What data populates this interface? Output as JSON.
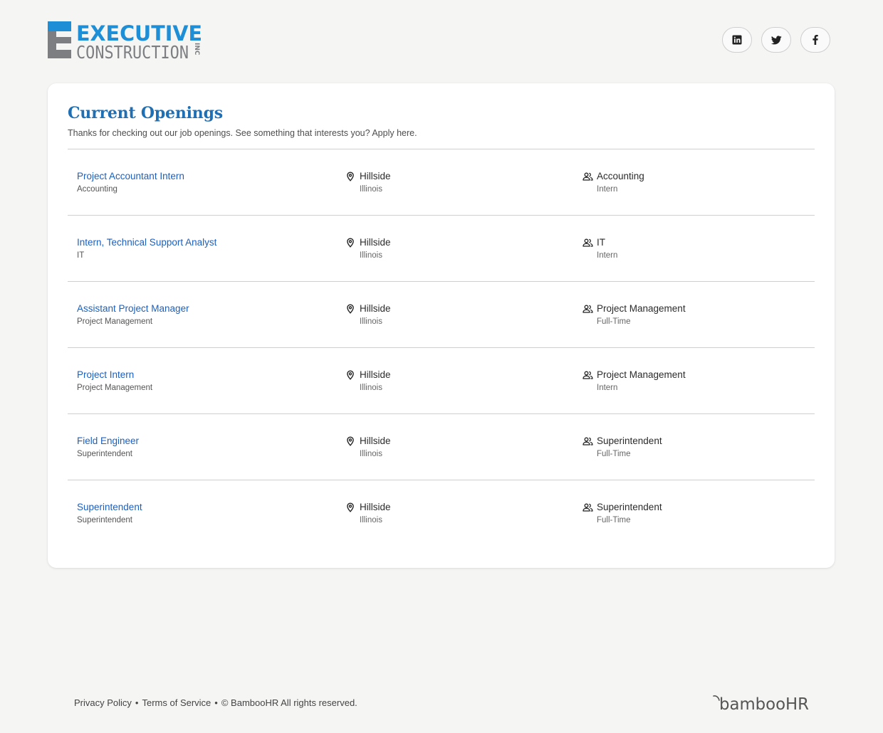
{
  "header": {
    "logo": {
      "line1": "EXECUTIVE",
      "line2": "CONSTRUCTION",
      "suffix": "INC",
      "colors": {
        "blue": "#1e8fd6",
        "gray": "#7c7e81"
      }
    },
    "social": [
      {
        "name": "linkedin",
        "icon": "linkedin-icon"
      },
      {
        "name": "twitter",
        "icon": "twitter-icon"
      },
      {
        "name": "facebook",
        "icon": "facebook-icon"
      }
    ]
  },
  "openings": {
    "title": "Current Openings",
    "subtitle": "Thanks for checking out our job openings. See something that interests you? Apply here.",
    "jobs": [
      {
        "title": "Project Accountant Intern",
        "department": "Accounting",
        "city": "Hillside",
        "state": "Illinois",
        "team": "Accounting",
        "employment_type": "Intern"
      },
      {
        "title": "Intern, Technical Support Analyst",
        "department": "IT",
        "city": "Hillside",
        "state": "Illinois",
        "team": "IT",
        "employment_type": "Intern"
      },
      {
        "title": "Assistant Project Manager",
        "department": "Project Management",
        "city": "Hillside",
        "state": "Illinois",
        "team": "Project Management",
        "employment_type": "Full-Time"
      },
      {
        "title": "Project Intern",
        "department": "Project Management",
        "city": "Hillside",
        "state": "Illinois",
        "team": "Project Management",
        "employment_type": "Intern"
      },
      {
        "title": "Field Engineer",
        "department": "Superintendent",
        "city": "Hillside",
        "state": "Illinois",
        "team": "Superintendent",
        "employment_type": "Full-Time"
      },
      {
        "title": "Superintendent",
        "department": "Superintendent",
        "city": "Hillside",
        "state": "Illinois",
        "team": "Superintendent",
        "employment_type": "Full-Time"
      }
    ],
    "icons": {
      "location": "map-pin-icon",
      "team": "people-icon"
    },
    "colors": {
      "title": "#1f6fb5",
      "link": "#1b5fbf"
    }
  },
  "footer": {
    "privacy": "Privacy Policy",
    "terms": "Terms of Service",
    "separator": "•",
    "copyright": "© BambooHR All rights reserved.",
    "brand": "bambooHR"
  }
}
